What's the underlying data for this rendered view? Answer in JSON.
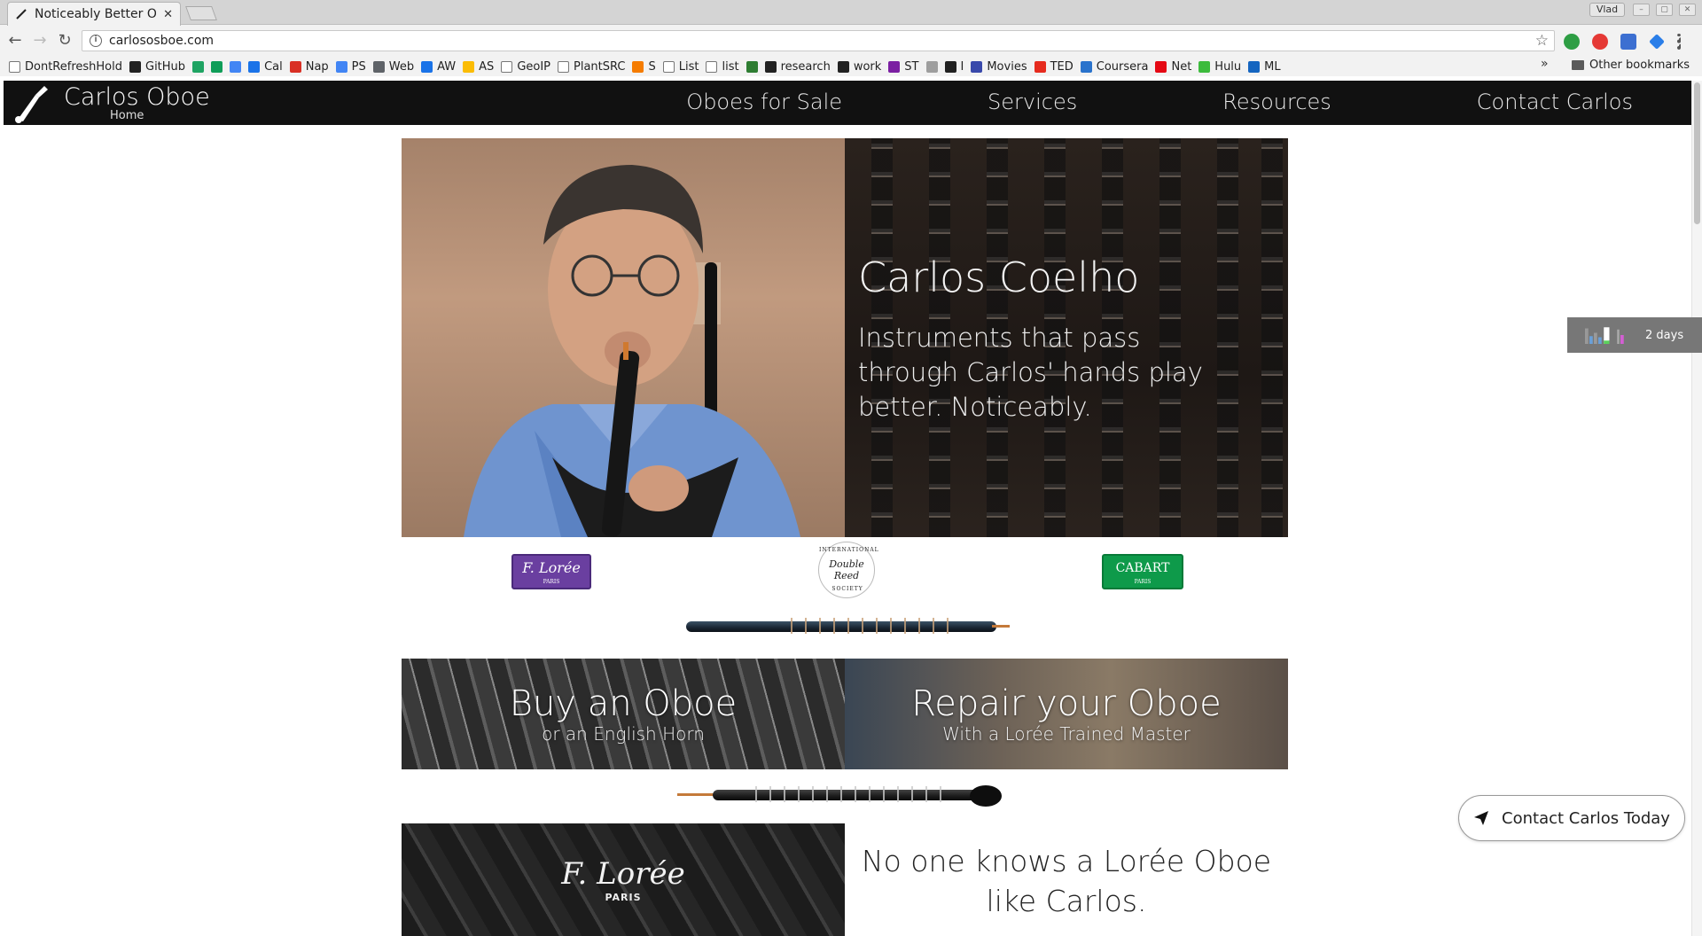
{
  "browser": {
    "tab_title": "Noticeably Better Oboes",
    "user_label": "Vlad",
    "url": "carlososboe.com",
    "bookmarks": [
      {
        "label": "DontRefreshHold",
        "icon": "page-icon",
        "color": "#ffffff"
      },
      {
        "label": "GitHub",
        "icon": "github-icon",
        "color": "#222222"
      },
      {
        "label": "",
        "icon": "drive-icon",
        "color": "#1fa463"
      },
      {
        "label": "",
        "icon": "sheets-icon",
        "color": "#0f9d58"
      },
      {
        "label": "",
        "icon": "docs-icon",
        "color": "#4285f4"
      },
      {
        "label": "Cal",
        "icon": "calendar-icon",
        "color": "#1a73e8"
      },
      {
        "label": "Nap",
        "icon": "gmail-icon",
        "color": "#d93025"
      },
      {
        "label": "PS",
        "icon": "google-icon",
        "color": "#4285f4"
      },
      {
        "label": "Web",
        "icon": "web-icon",
        "color": "#5f6368"
      },
      {
        "label": "AW",
        "icon": "adwords-icon",
        "color": "#1a73e8"
      },
      {
        "label": "AS",
        "icon": "adsense-icon",
        "color": "#fbbc04"
      },
      {
        "label": "GeoIP",
        "icon": "page-icon",
        "color": "#ffffff"
      },
      {
        "label": "PlantSRC",
        "icon": "page-icon",
        "color": "#ffffff"
      },
      {
        "label": "S",
        "icon": "orange-icon",
        "color": "#f57c00"
      },
      {
        "label": "List",
        "icon": "page-icon",
        "color": "#ffffff"
      },
      {
        "label": "list",
        "icon": "page-icon",
        "color": "#ffffff"
      },
      {
        "label": "",
        "icon": "gear-green-icon",
        "color": "#2e7d32"
      },
      {
        "label": "research",
        "icon": "github-icon",
        "color": "#222222"
      },
      {
        "label": "work",
        "icon": "github-icon",
        "color": "#222222"
      },
      {
        "label": "ST",
        "icon": "brackets-icon",
        "color": "#7b1fa2"
      },
      {
        "label": "",
        "icon": "circle-icon",
        "color": "#9e9e9e"
      },
      {
        "label": "I",
        "icon": "dark-icon",
        "color": "#212121"
      },
      {
        "label": "Movies",
        "icon": "movies-icon",
        "color": "#3949ab"
      },
      {
        "label": "TED",
        "icon": "ted-icon",
        "color": "#e62b1e"
      },
      {
        "label": "Coursera",
        "icon": "coursera-icon",
        "color": "#2a73cc"
      },
      {
        "label": "Net",
        "icon": "netflix-icon",
        "color": "#e50914"
      },
      {
        "label": "Hulu",
        "icon": "hulu-icon",
        "color": "#3dbb3d"
      },
      {
        "label": "ML",
        "icon": "k-icon",
        "color": "#1565c0"
      }
    ],
    "overflow_label": "»",
    "other_bookmarks": "Other bookmarks"
  },
  "site": {
    "brand_name": "Carlos Oboe",
    "brand_sub": "Home",
    "nav": [
      "Oboes for Sale",
      "Services",
      "Resources",
      "Contact Carlos"
    ],
    "hero": {
      "title": "Carlos Coelho",
      "subtitle": "Instruments that pass through Carlos' hands play better. Noticeably."
    },
    "partners": {
      "loree": "F. Lorée",
      "loree_city": "PARIS",
      "idrs_top": "INTERNATIONAL",
      "idrs_mid": "Double Reed",
      "idrs_bottom": "SOCIETY",
      "cabart": "CABART",
      "cabart_city": "PARIS"
    },
    "cards": [
      {
        "title": "Buy an Oboe",
        "sub": "or an English Horn"
      },
      {
        "title": "Repair your Oboe",
        "sub": "With a Lorée Trained Master"
      }
    ],
    "loree_block": {
      "script": "F. Lorée",
      "city": "PARIS"
    },
    "knows_text": "No one knows a Lorée Oboe like Carlos.",
    "cta": "Contact Carlos Today"
  },
  "widget": {
    "label": "2 days"
  }
}
